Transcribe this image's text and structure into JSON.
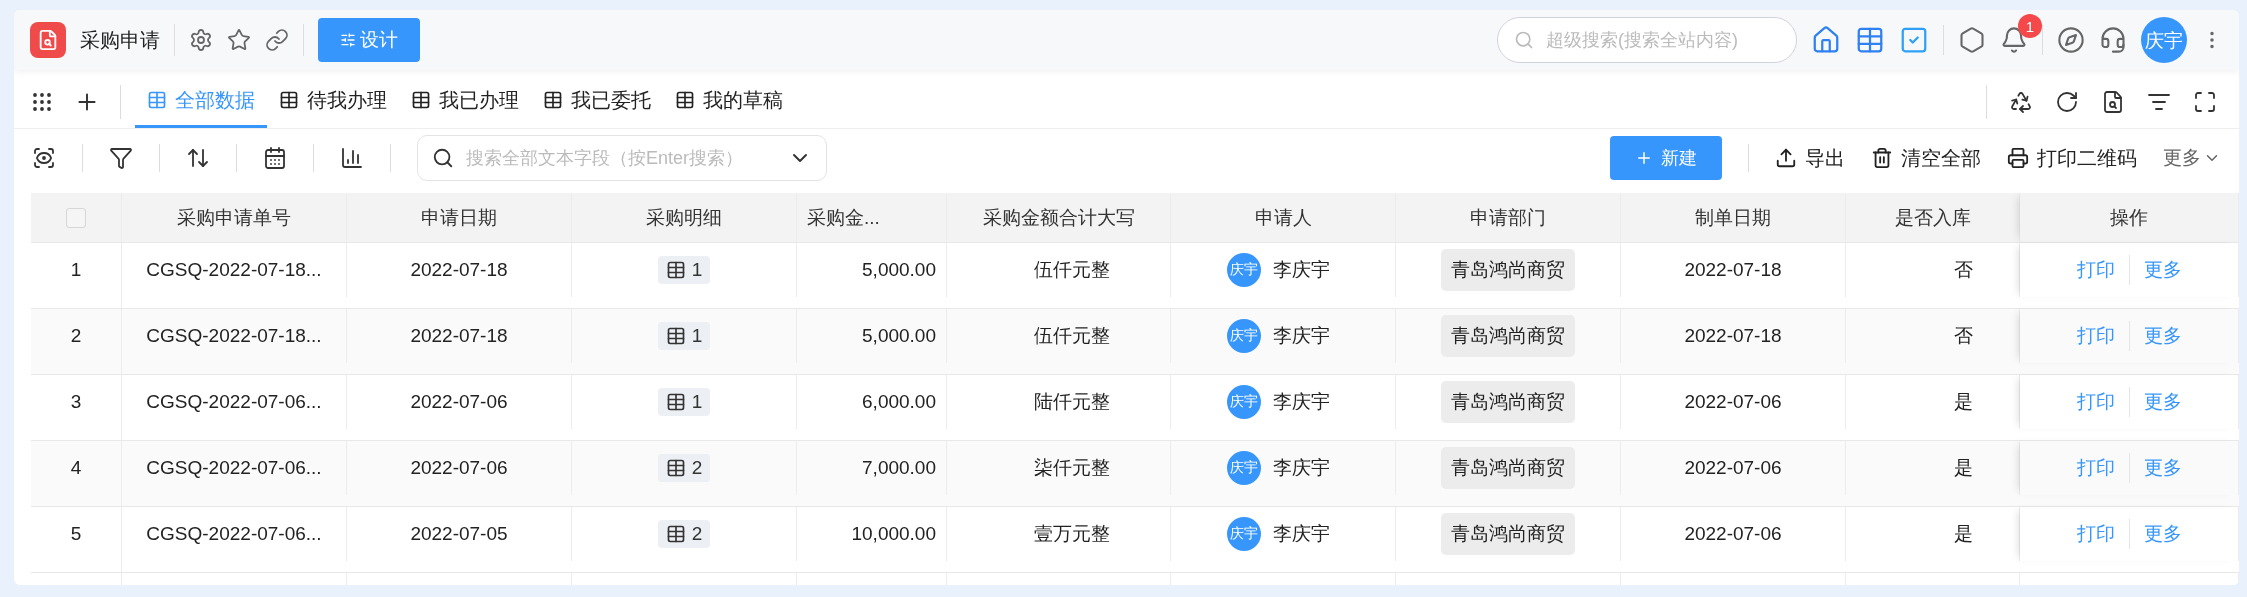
{
  "app_bar": {
    "title": "采购申请",
    "design_button": "设计",
    "search": {
      "placeholder": "超级搜索(搜索全站内容)"
    },
    "notification_count": "1",
    "avatar": "庆宇"
  },
  "tabs": [
    {
      "label": "全部数据",
      "selected": true
    },
    {
      "label": "待我办理",
      "selected": false
    },
    {
      "label": "我已办理",
      "selected": false
    },
    {
      "label": "我已委托",
      "selected": false
    },
    {
      "label": "我的草稿",
      "selected": false
    }
  ],
  "toolbar": {
    "search": {
      "placeholder": "搜索全部文本字段（按Enter搜索）"
    },
    "new_button": "新建",
    "actions": [
      "导出",
      "清空全部",
      "打印二维码"
    ],
    "more": "更多"
  },
  "table": {
    "select_all": {
      "checked": false
    },
    "columns": [
      "采购申请单号",
      "申请日期",
      "采购明细",
      "采购金...",
      "采购金额合计大写",
      "申请人",
      "申请部门",
      "制单日期",
      "是否入库",
      "操作"
    ],
    "rows": [
      {
        "index": "1",
        "number": "CGSQ-2022-07-18...",
        "date": "2022-07-18",
        "details": "1",
        "amount": "5,000.00",
        "amount_words": "伍仟元整",
        "applicant_avatar": "庆宇",
        "applicant": "李庆宇",
        "department": "青岛鸿尚商贸",
        "created": "2022-07-18",
        "stocked": "否",
        "actions": [
          "打印",
          "更多"
        ]
      },
      {
        "index": "2",
        "number": "CGSQ-2022-07-18...",
        "date": "2022-07-18",
        "details": "1",
        "amount": "5,000.00",
        "amount_words": "伍仟元整",
        "applicant_avatar": "庆宇",
        "applicant": "李庆宇",
        "department": "青岛鸿尚商贸",
        "created": "2022-07-18",
        "stocked": "否",
        "actions": [
          "打印",
          "更多"
        ]
      },
      {
        "index": "3",
        "number": "CGSQ-2022-07-06...",
        "date": "2022-07-06",
        "details": "1",
        "amount": "6,000.00",
        "amount_words": "陆仟元整",
        "applicant_avatar": "庆宇",
        "applicant": "李庆宇",
        "department": "青岛鸿尚商贸",
        "created": "2022-07-06",
        "stocked": "是",
        "actions": [
          "打印",
          "更多"
        ]
      },
      {
        "index": "4",
        "number": "CGSQ-2022-07-06...",
        "date": "2022-07-06",
        "details": "2",
        "amount": "7,000.00",
        "amount_words": "柒仟元整",
        "applicant_avatar": "庆宇",
        "applicant": "李庆宇",
        "department": "青岛鸿尚商贸",
        "created": "2022-07-06",
        "stocked": "是",
        "actions": [
          "打印",
          "更多"
        ]
      },
      {
        "index": "5",
        "number": "CGSQ-2022-07-06...",
        "date": "2022-07-05",
        "details": "2",
        "amount": "10,000.00",
        "amount_words": "壹万元整",
        "applicant_avatar": "庆宇",
        "applicant": "李庆宇",
        "department": "青岛鸿尚商贸",
        "created": "2022-07-06",
        "stocked": "是",
        "actions": [
          "打印",
          "更多"
        ]
      }
    ]
  }
}
